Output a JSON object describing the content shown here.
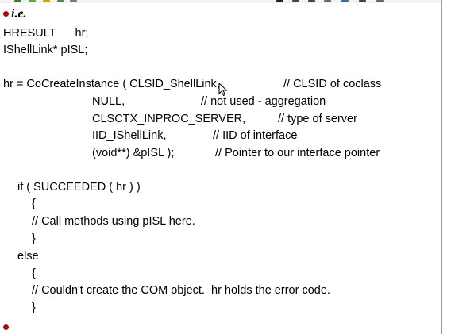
{
  "heading": "i.e.",
  "code_lines": {
    "decl_hresult": "HRESULT      hr;",
    "decl_ishelllink": "IShellLink* pISL;",
    "call_head": "hr = CoCreateInstance ( CLSID_ShellLink,",
    "call_head_comment": "// CLSID of coclass",
    "arg_null": "NULL,",
    "arg_null_comment": "// not used - aggregation",
    "arg_ctx": "CLSCTX_INPROC_SERVER,",
    "arg_ctx_comment": "// type of server",
    "arg_iid": "IID_IShellLink,",
    "arg_iid_comment": "// IID of interface",
    "arg_ptr": "(void**) &pISL );",
    "arg_ptr_comment": "// Pointer to our interface pointer",
    "if_line": "if ( SUCCEEDED ( hr ) )",
    "brace_open_1": "{",
    "call_methods": "// Call methods using pISL here.",
    "brace_close_1": "}",
    "else_line": "else",
    "brace_open_2": "{",
    "error_comment": "// Couldn't create the COM object.  hr holds the error code.",
    "brace_close_2": "}"
  },
  "colors": {
    "bullet": "#a01010",
    "text": "#000000",
    "background": "#ffffff"
  },
  "icons": [
    "bullet-icon",
    "mouse-cursor-icon"
  ]
}
